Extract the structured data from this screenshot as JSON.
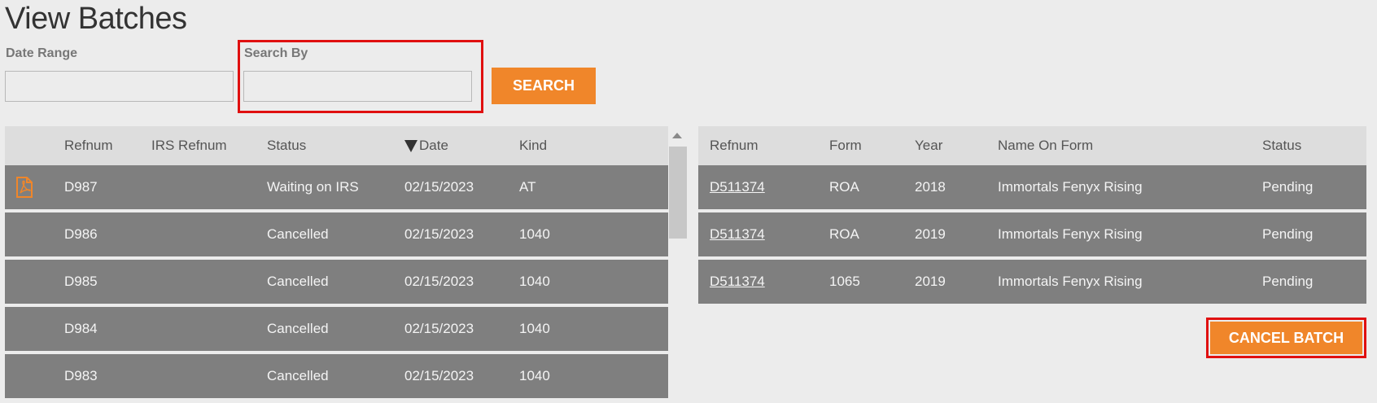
{
  "page": {
    "title": "View Batches"
  },
  "filters": {
    "date_range_label": "Date Range",
    "date_range_value": "",
    "search_by_label": "Search By",
    "search_by_value": "",
    "search_button": "SEARCH"
  },
  "batches": {
    "headers": {
      "refnum": "Refnum",
      "irs_refnum": "IRS Refnum",
      "status": "Status",
      "date": "Date",
      "kind": "Kind"
    },
    "sort": {
      "column": "date",
      "direction": "descending"
    },
    "rows": [
      {
        "refnum": "D987",
        "irs_refnum": "",
        "status": "Waiting on IRS",
        "date": "02/15/2023",
        "kind": "AT",
        "has_pdf": true
      },
      {
        "refnum": "D986",
        "irs_refnum": "",
        "status": "Cancelled",
        "date": "02/15/2023",
        "kind": "1040",
        "has_pdf": false
      },
      {
        "refnum": "D985",
        "irs_refnum": "",
        "status": "Cancelled",
        "date": "02/15/2023",
        "kind": "1040",
        "has_pdf": false
      },
      {
        "refnum": "D984",
        "irs_refnum": "",
        "status": "Cancelled",
        "date": "02/15/2023",
        "kind": "1040",
        "has_pdf": false
      },
      {
        "refnum": "D983",
        "irs_refnum": "",
        "status": "Cancelled",
        "date": "02/15/2023",
        "kind": "1040",
        "has_pdf": false
      }
    ]
  },
  "batch_detail": {
    "headers": {
      "refnum": "Refnum",
      "form": "Form",
      "year": "Year",
      "name_on_form": "Name On Form",
      "status": "Status"
    },
    "rows": [
      {
        "refnum": "D511374",
        "form": "ROA",
        "year": "2018",
        "name_on_form": "Immortals Fenyx Rising",
        "status": "Pending"
      },
      {
        "refnum": "D511374",
        "form": "ROA",
        "year": "2019",
        "name_on_form": "Immortals Fenyx Rising",
        "status": "Pending"
      },
      {
        "refnum": "D511374",
        "form": "1065",
        "year": "2019",
        "name_on_form": "Immortals Fenyx Rising",
        "status": "Pending"
      }
    ],
    "cancel_button": "CANCEL BATCH"
  },
  "colors": {
    "accent": "#f0862a",
    "highlight": "#e01010",
    "row_bg": "#7f7f7f",
    "header_bg": "#dddddd",
    "page_bg": "#ececec"
  },
  "icons": {
    "pdf": "pdf-file-icon",
    "sort": "sort-down-arrow-icon",
    "scroll_up": "scroll-up-arrow-icon"
  }
}
